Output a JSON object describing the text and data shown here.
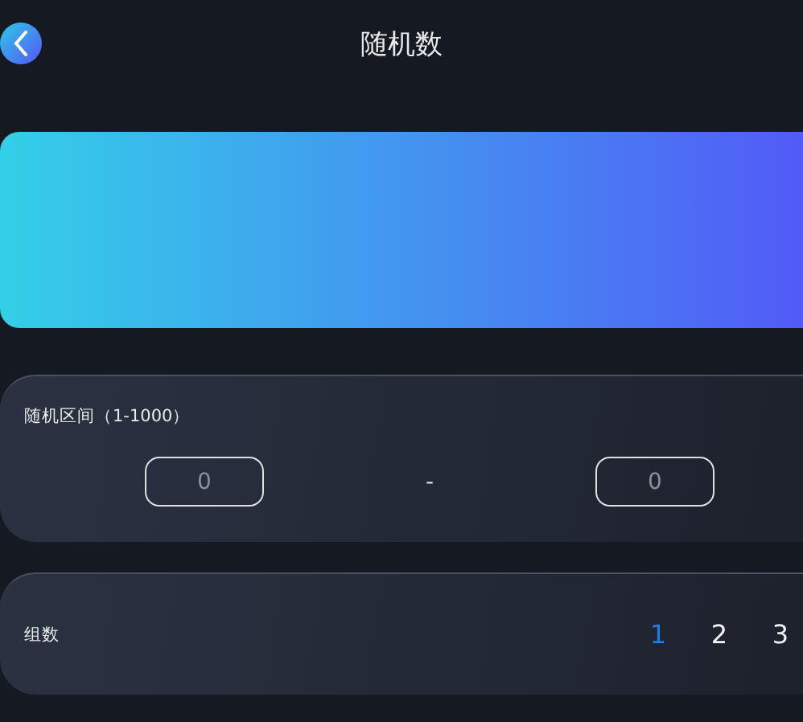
{
  "header": {
    "title": "随机数"
  },
  "range": {
    "label": "随机区间（1-1000）",
    "min": {
      "placeholder": "0"
    },
    "separator": "-",
    "max": {
      "placeholder": "0"
    }
  },
  "groups": {
    "label": "组数",
    "options": [
      {
        "label": "1",
        "selected": true
      },
      {
        "label": "2",
        "selected": false
      },
      {
        "label": "3",
        "selected": false
      }
    ]
  }
}
